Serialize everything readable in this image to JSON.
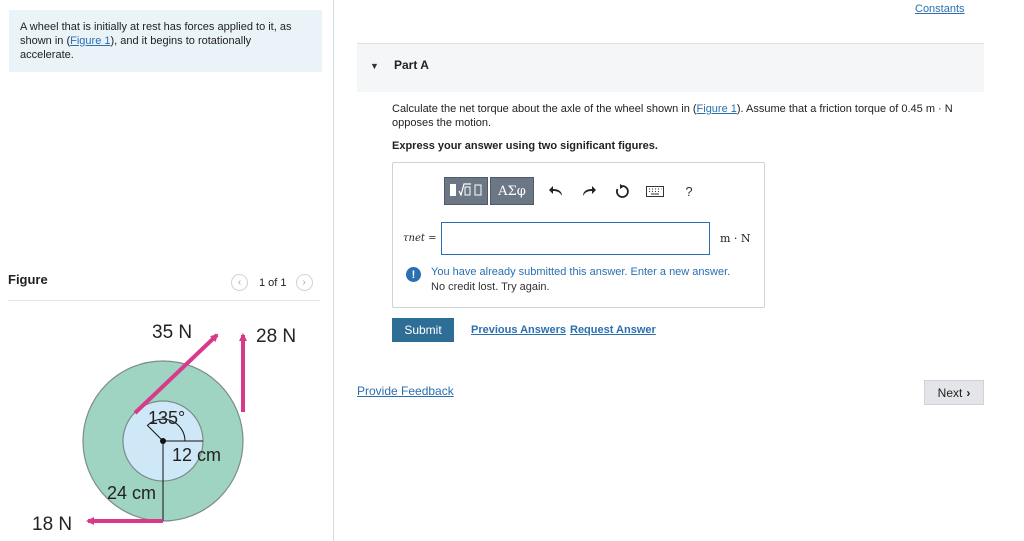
{
  "intro": {
    "line1": "A wheel that is initially at rest has forces applied to it, as",
    "line2_before": "shown in (",
    "line2_link": "Figure 1",
    "line2_after": "), and it begins to rotationally",
    "line3": "accelerate."
  },
  "figure_panel": {
    "title": "Figure",
    "counter": "1 of 1",
    "prev_icon": "chevron-left-icon",
    "next_icon": "chevron-right-icon",
    "labels": {
      "force_top_left": "35 N",
      "force_top_right": "28 N",
      "force_bottom": "18 N",
      "angle": "135°",
      "inner_radius": "12 cm",
      "outer_radius": "24 cm"
    },
    "colors": {
      "outer_wheel": "#9fd3c2",
      "inner_hub": "#cfe8f7",
      "arrow": "#d9398a"
    }
  },
  "header": {
    "constants_link": "Constants"
  },
  "part": {
    "title": "Part A",
    "caret_icon": "caret-down-icon"
  },
  "question": {
    "text_before": "Calculate the net torque about the axle of the wheel shown in (",
    "link": "Figure 1",
    "text_after": "). Assume that a friction torque of 0.45 m · N",
    "text_line2": "opposes the motion.",
    "instruction": "Express your answer using two significant figures."
  },
  "answer": {
    "toolbar": {
      "template_icon": "template-icon",
      "greek_label": "ΑΣφ",
      "undo_icon": "undo-icon",
      "redo_icon": "redo-icon",
      "reset_icon": "reset-icon",
      "keyboard_icon": "keyboard-icon",
      "help_label": "?"
    },
    "variable_label": "τnet =",
    "input_value": "",
    "unit": "m · N",
    "warning_line1": "You have already submitted this answer. Enter a new answer.",
    "warning_line2": "No credit lost. Try again."
  },
  "actions": {
    "submit": "Submit",
    "previous_answers": "Previous Answers",
    "request_answer": "Request Answer",
    "provide_feedback": "Provide Feedback",
    "next": "Next"
  },
  "colors": {
    "link": "#2a6fb1",
    "submit_bg": "#2e6e96",
    "intro_bg": "#eaf3f8"
  }
}
